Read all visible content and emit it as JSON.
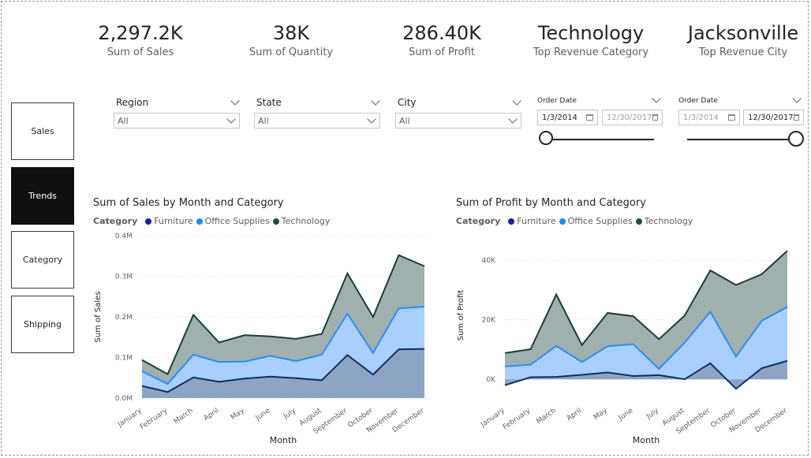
{
  "kpis": [
    {
      "value": "2,297.2K",
      "label": "Sum of Sales"
    },
    {
      "value": "38K",
      "label": "Sum of Quantity"
    },
    {
      "value": "286.40K",
      "label": "Sum of Profit"
    },
    {
      "value": "Technology",
      "label": "Top Revenue Category"
    },
    {
      "value": "Jacksonville",
      "label": "Top Revenue City"
    }
  ],
  "nav": [
    {
      "label": "Sales",
      "active": false
    },
    {
      "label": "Trends",
      "active": true
    },
    {
      "label": "Category",
      "active": false
    },
    {
      "label": "Shipping",
      "active": false
    }
  ],
  "slicers": [
    {
      "title": "Region",
      "value": "All"
    },
    {
      "title": "State",
      "value": "All"
    },
    {
      "title": "City",
      "value": "All"
    }
  ],
  "date_slicers": [
    {
      "title": "Order Date",
      "start": "1/3/2014",
      "end": "12/30/2017",
      "active_end": "start"
    },
    {
      "title": "Order Date",
      "start": "1/3/2014",
      "end": "12/30/2017",
      "active_end": "end"
    }
  ],
  "colors": {
    "furniture": "#12239E",
    "office": "#118DFF",
    "technology": "#1C4C45"
  },
  "chart_data": [
    {
      "type": "area",
      "title": "Sum of Sales by Month and Category",
      "legend_title": "Category",
      "xlabel": "Month",
      "ylabel": "Sum of Sales",
      "categories": [
        "January",
        "February",
        "March",
        "April",
        "May",
        "June",
        "July",
        "August",
        "September",
        "October",
        "November",
        "December"
      ],
      "yticks": [
        "0.0M",
        "0.1M",
        "0.2M",
        "0.3M",
        "0.4M"
      ],
      "ylim": [
        0,
        0.4
      ],
      "series": [
        {
          "name": "Furniture",
          "values": [
            0.03,
            0.015,
            0.051,
            0.04,
            0.048,
            0.053,
            0.049,
            0.044,
            0.106,
            0.058,
            0.12,
            0.121
          ]
        },
        {
          "name": "Office Supplies",
          "values": [
            0.066,
            0.035,
            0.107,
            0.089,
            0.09,
            0.104,
            0.091,
            0.107,
            0.208,
            0.111,
            0.221,
            0.225
          ]
        },
        {
          "name": "Technology",
          "values": [
            0.094,
            0.059,
            0.205,
            0.137,
            0.155,
            0.152,
            0.146,
            0.158,
            0.307,
            0.2,
            0.352,
            0.325
          ]
        }
      ]
    },
    {
      "type": "area",
      "title": "Sum of Profit by Month and Category",
      "legend_title": "Category",
      "xlabel": "Month",
      "ylabel": "Sum of Profit",
      "categories": [
        "January",
        "February",
        "March",
        "April",
        "May",
        "June",
        "July",
        "August",
        "September",
        "October",
        "November",
        "December"
      ],
      "yticks": [
        "0K",
        "20K",
        "40K"
      ],
      "ylim": [
        -5,
        48
      ],
      "series": [
        {
          "name": "Furniture",
          "values": [
            -2,
            0.7,
            0.8,
            1.5,
            2.3,
            1.1,
            1.4,
            0,
            5.4,
            -3.2,
            3.7,
            6.2
          ]
        },
        {
          "name": "Office Supplies",
          "values": [
            4.3,
            4.9,
            11.2,
            5.8,
            11.1,
            11.8,
            3.5,
            12.3,
            22.7,
            7.6,
            19.6,
            24.3
          ]
        },
        {
          "name": "Technology",
          "values": [
            8.8,
            10.1,
            28.5,
            11.5,
            22.3,
            21.2,
            13.5,
            21.4,
            36.6,
            31.7,
            35.3,
            43.2
          ]
        }
      ]
    }
  ]
}
